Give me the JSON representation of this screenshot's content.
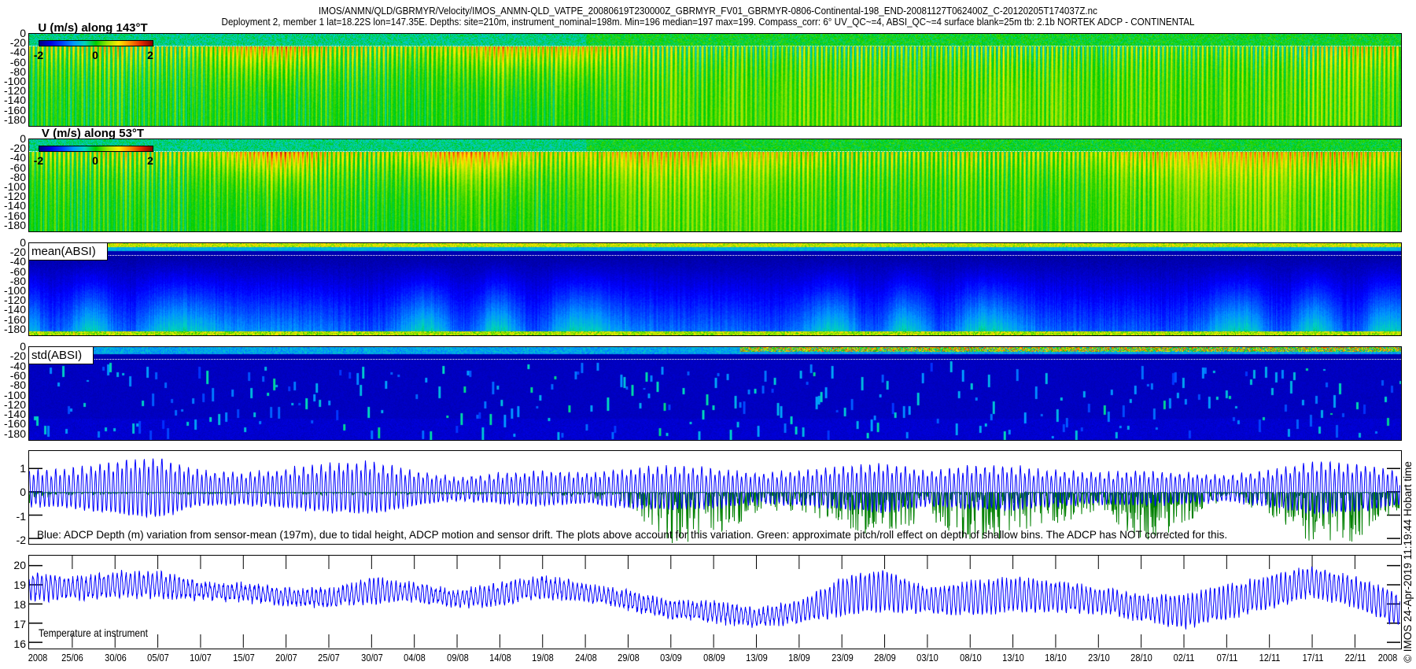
{
  "header": {
    "line1": "IMOS/ANMN/QLD/GBRMYR/Velocity/IMOS_ANMN-QLD_VATPE_20080619T230000Z_GBRMYR_FV01_GBRMYR-0806-Continental-198_END-20081127T062400Z_C-20120205T174037Z.nc",
    "line2": "Deployment 2, member 1 lat=18.22S lon=147.35E. Depths: site=210m, instrument_nominal=198m. Min=196 median=197 max=199. Compass_corr: 6° UV_QC~=4, ABSI_QC~=4 surface blank=25m tb: 2.1b NORTEK ADCP - CONTINENTAL"
  },
  "credit": "© IMOS 24-Apr-2019 11:19:44 Hobart time",
  "chart_data": {
    "type": "heatmap",
    "x": {
      "units": "days since 25/06/2008",
      "xlim": [
        -5.05,
        155.3
      ],
      "tick_days": [
        0,
        5,
        10,
        15,
        20,
        25,
        30,
        35,
        40,
        45,
        50,
        55,
        60,
        65,
        70,
        75,
        80,
        85,
        90,
        95,
        100,
        105,
        110,
        115,
        120,
        125,
        130,
        135,
        140,
        145,
        150
      ],
      "tick_labels": [
        "25/06",
        "30/06",
        "05/07",
        "10/07",
        "15/07",
        "20/07",
        "25/07",
        "30/07",
        "04/08",
        "09/08",
        "14/08",
        "19/08",
        "24/08",
        "29/08",
        "03/09",
        "08/09",
        "13/09",
        "18/09",
        "23/09",
        "28/09",
        "03/10",
        "08/10",
        "13/10",
        "18/10",
        "23/10",
        "28/10",
        "02/11",
        "07/11",
        "12/11",
        "17/11",
        "22/11"
      ],
      "year_left": "2008",
      "year_right": "2008"
    },
    "key_days": [
      -5,
      0,
      5,
      10,
      15,
      20,
      25,
      30,
      35,
      40,
      45,
      50,
      55,
      60,
      65,
      70,
      75,
      80,
      85,
      90,
      95,
      100,
      105,
      110,
      115,
      120,
      125,
      130,
      135,
      140,
      145,
      150,
      155
    ],
    "surface_blank_m": 25,
    "tidal_period_days": 0.5175,
    "panels": [
      {
        "id": "u",
        "type": "heatmap",
        "label": "U (m/s) along 143°T",
        "ylim": [
          -195,
          0
        ],
        "yticks": [
          0,
          -20,
          -40,
          -60,
          -80,
          -100,
          -120,
          -140,
          -160,
          -180
        ],
        "colorbar": {
          "range": [
            -2,
            2
          ],
          "ticks": [
            "-2",
            "0",
            "2"
          ]
        },
        "surface_mean": [
          0.3,
          0.4,
          0.5,
          0.3,
          0.4,
          0.9,
          1.0,
          0.5,
          0.4,
          0.4,
          0.6,
          1.0,
          0.8,
          0.9,
          0.4,
          0.2,
          0.1,
          0.1,
          0.1,
          0.1,
          0.1,
          0.1,
          0.1,
          0.1,
          0.1,
          0.1,
          0.2,
          0.2,
          0.2,
          0.1,
          0.3,
          0.6,
          0.5
        ],
        "deep_mean": [
          0,
          0,
          0,
          0,
          0,
          0,
          0,
          0,
          0,
          0,
          0,
          0,
          0,
          0.05,
          0.1,
          0.2,
          0.2,
          0.2,
          0.25,
          0.25,
          0.2,
          0.2,
          0.25,
          0.3,
          0.25,
          0.2,
          0.2,
          0.2,
          0.2,
          0.2,
          0.3,
          0.25,
          0.1
        ],
        "tide_amp": [
          0.8,
          0.9,
          1.0,
          1.0,
          0.7,
          0.7,
          0.8,
          0.9,
          0.9,
          0.7,
          0.6,
          0.7,
          0.8,
          0.7,
          0.8,
          0.9,
          0.8,
          0.7,
          0.8,
          0.9,
          0.9,
          0.8,
          0.9,
          0.9,
          0.8,
          0.7,
          0.8,
          0.7,
          0.7,
          0.8,
          1.0,
          0.9,
          0.8
        ]
      },
      {
        "id": "v",
        "type": "heatmap",
        "label": "V (m/s) along 53°T",
        "ylim": [
          -195,
          0
        ],
        "yticks": [
          0,
          -20,
          -40,
          -60,
          -80,
          -100,
          -120,
          -140,
          -160,
          -180
        ],
        "colorbar": {
          "range": [
            -2,
            2
          ],
          "ticks": [
            "-2",
            "0",
            "2"
          ]
        },
        "surface_mean": [
          0.3,
          0.4,
          0.5,
          0.4,
          0.5,
          0.9,
          1.3,
          0.6,
          0.5,
          0.7,
          1.2,
          1.0,
          0.6,
          0.6,
          0.9,
          0.9,
          0.8,
          0.8,
          0.7,
          0.4,
          0.4,
          0.4,
          0.5,
          0.4,
          0.5,
          0.5,
          0.8,
          0.9,
          0.9,
          0.9,
          0.8,
          0.8,
          0.6
        ],
        "deep_mean": [
          0,
          0,
          0,
          0,
          0,
          0,
          0.05,
          0.05,
          0,
          0,
          0.05,
          0.05,
          0.05,
          0.1,
          0.2,
          0.25,
          0.2,
          0.2,
          0.15,
          0.1,
          0.1,
          0.1,
          0.1,
          0.1,
          0.1,
          0.1,
          0.2,
          0.25,
          0.25,
          0.25,
          0.2,
          0.2,
          0.1
        ],
        "tide_amp": [
          0.7,
          0.8,
          0.9,
          0.9,
          0.6,
          0.6,
          0.7,
          0.8,
          0.8,
          0.6,
          0.5,
          0.6,
          0.7,
          0.6,
          0.7,
          0.8,
          0.7,
          0.6,
          0.7,
          0.8,
          0.8,
          0.7,
          0.8,
          0.8,
          0.7,
          0.6,
          0.7,
          0.6,
          0.6,
          0.7,
          0.9,
          0.8,
          0.7
        ]
      },
      {
        "id": "absi_mean",
        "type": "heatmap",
        "label": "mean(ABSI)",
        "ylim": [
          -195,
          0
        ],
        "yticks": [
          0,
          -20,
          -40,
          -60,
          -80,
          -100,
          -120,
          -140,
          -160,
          -180
        ]
      },
      {
        "id": "absi_std",
        "type": "heatmap",
        "label": "std(ABSI)",
        "ylim": [
          -195,
          0
        ],
        "yticks": [
          0,
          -20,
          -40,
          -60,
          -80,
          -100,
          -120,
          -140,
          -160,
          -180
        ]
      },
      {
        "id": "depth",
        "type": "line",
        "ylim": [
          -2.2,
          1.75
        ],
        "yticks": [
          1,
          0,
          -1,
          -2
        ],
        "note": "Blue: ADCP Depth (m) variation from sensor-mean (197m), due to tidal height, ADCP motion and sensor drift. The plots above account for this variation. Green: approximate pitch/roll effect on depth of shallow bins. The ADCP has NOT corrected for this.",
        "series": [
          {
            "name": "ADCP depth variation (m)",
            "color": "#0000ff",
            "amplitude": [
              0.8,
              0.9,
              1.2,
              1.4,
              0.8,
              0.7,
              0.9,
              1.1,
              1.2,
              0.8,
              0.5,
              0.7,
              0.8,
              0.7,
              0.9,
              1.0,
              0.9,
              0.7,
              0.8,
              1.0,
              1.1,
              0.8,
              1.0,
              1.0,
              0.8,
              0.7,
              0.8,
              0.7,
              0.6,
              0.8,
              1.2,
              1.1,
              0.8
            ]
          },
          {
            "name": "pitch/roll effect (m)",
            "color": "#008000",
            "min": [
              -0.6,
              -0.2,
              -0.1,
              -0.1,
              -0.1,
              -0.1,
              -0.1,
              -0.2,
              -0.2,
              -0.1,
              -0.1,
              -0.1,
              -0.2,
              -0.3,
              -0.8,
              -2.2,
              -2.2,
              -1.0,
              -0.8,
              -1.5,
              -2.2,
              -1.2,
              -2.2,
              -2.0,
              -1.5,
              -0.8,
              -2.2,
              -1.5,
              -0.3,
              -1.0,
              -2.2,
              -2.2,
              -0.8
            ]
          }
        ]
      },
      {
        "id": "temperature",
        "type": "line",
        "ylim": [
          15.72,
          20.52
        ],
        "yticks": [
          20,
          19,
          18,
          17,
          16
        ],
        "note": "Temperature at instrument",
        "series": [
          {
            "name": "Temperature",
            "color": "#0000ff",
            "mean": [
              18.9,
              18.8,
              19.0,
              19.0,
              18.7,
              18.6,
              18.4,
              18.3,
              18.7,
              18.6,
              18.3,
              18.5,
              18.9,
              18.6,
              18.2,
              17.7,
              17.6,
              17.3,
              17.6,
              18.4,
              18.7,
              18.2,
              18.3,
              18.5,
              18.4,
              18.2,
              17.8,
              17.6,
              18.1,
              18.6,
              19.2,
              18.6,
              17.7
            ],
            "amplitude": [
              0.7,
              0.5,
              0.6,
              0.6,
              0.4,
              0.4,
              0.4,
              0.4,
              0.6,
              0.4,
              0.4,
              0.5,
              0.5,
              0.4,
              0.4,
              0.4,
              0.5,
              0.4,
              0.5,
              0.9,
              1.0,
              0.6,
              0.8,
              0.8,
              0.7,
              0.6,
              0.6,
              0.8,
              0.8,
              0.8,
              0.7,
              0.7,
              0.8
            ]
          }
        ]
      }
    ]
  }
}
